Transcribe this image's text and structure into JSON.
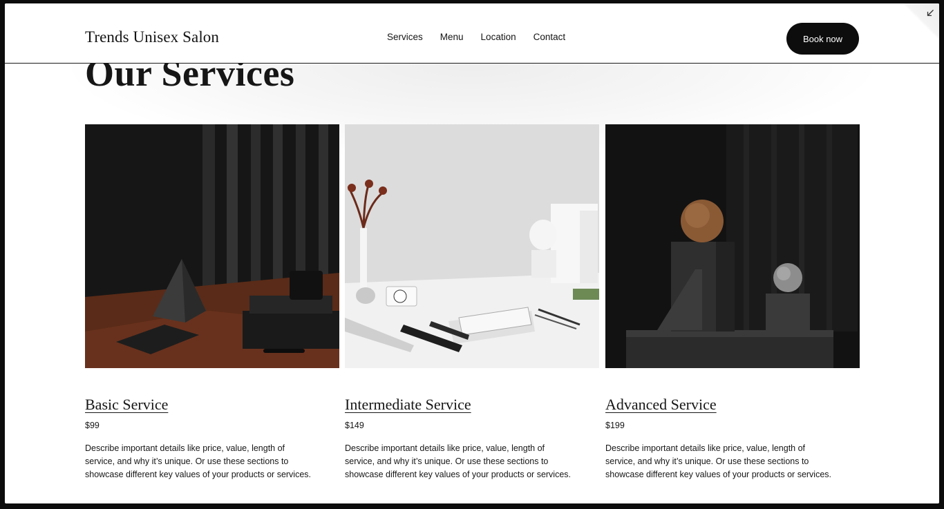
{
  "header": {
    "brand": "Trends Unisex Salon",
    "nav": [
      "Services",
      "Menu",
      "Location",
      "Contact"
    ],
    "cta_label": "Book now",
    "corner_icon": "collapse-arrow-icon"
  },
  "page": {
    "title": "Our Services"
  },
  "services": [
    {
      "title": "Basic Service",
      "price": "$99",
      "description": "Describe important details like price, value, length of service, and why it’s unique. Or use these sections to showcase different key values of your products or services.",
      "image": "dark-desk-pyramid-image"
    },
    {
      "title": "Intermediate Service",
      "price": "$149",
      "description": "Describe important details like price, value, length of service, and why it’s unique. Or use these sections to showcase different key values of your products or services.",
      "image": "white-desk-still-life-image"
    },
    {
      "title": "Advanced Service",
      "price": "$199",
      "description": "Describe important details like price, value, length of service, and why it’s unique. Or use these sections to showcase different key values of your products or services.",
      "image": "dark-pedestal-spheres-image"
    }
  ],
  "colors": {
    "background": "#ffffff",
    "text": "#161616",
    "button": "#0d0d0d",
    "button_text": "#ffffff"
  }
}
